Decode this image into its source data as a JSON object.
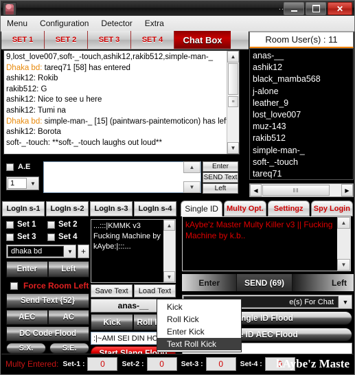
{
  "window": {
    "app_icon": "app-pixel-icon",
    "overflow_dots": "...",
    "minimize": "–",
    "maximize": "□",
    "close": "✕"
  },
  "menubar": {
    "items": [
      "Menu",
      "Configuration",
      "Detector",
      "Extra"
    ]
  },
  "set_tabs": {
    "items": [
      "SET 1",
      "SET 2",
      "SET 3",
      "SET 4"
    ],
    "selected": "Chat Box"
  },
  "room_header": {
    "text": "Room User(s) : 11"
  },
  "chat": {
    "lines": [
      {
        "nick": "",
        "text": "9,lost_love007,soft-_-touch,ashik12,rakib512,simple-man-_"
      },
      {
        "nick": "Dhaka bd:",
        "text": " tareq71 [58] has entered"
      },
      {
        "nick": "",
        "text": "ashik12: Rokib"
      },
      {
        "nick": "",
        "text": "rakib512: G"
      },
      {
        "nick": "",
        "text": "ashik12: Nice to see u here"
      },
      {
        "nick": "",
        "text": "ashik12: Tumi na"
      },
      {
        "nick": "Dhaka bd:",
        "text": " simple-man-_ [15] (paintwars-paintemoticon) has left"
      },
      {
        "nick": "",
        "text": "ashik12: Borota"
      },
      {
        "nick": "",
        "text": "soft-_-touch: **soft-_-touch laughs out loud**"
      }
    ],
    "scroll_up": "▲",
    "scroll_down": "▼",
    "thumb_grip": "≡"
  },
  "user_list": {
    "users": [
      "anas-__",
      "ashik12",
      "black_mamba568",
      "j-alone",
      "leather_9",
      "lost_love007",
      "muz-143",
      "rakib512",
      "simple-man-_",
      "soft-_-touch",
      "tareq71"
    ],
    "scroll_left": "◀",
    "scroll_right": "▶",
    "thumb_grip": "‖‖"
  },
  "chat_input": {
    "ae_label": "A.E",
    "count_value": "1",
    "count_arrow": "▼",
    "message_value": "",
    "scroll_up": "▲",
    "scroll_down": "▼",
    "buttons": [
      "Enter",
      "SEND Text",
      "Left"
    ]
  },
  "login_tabs": {
    "items": [
      "LogIn s-1",
      "LogIn s-2",
      "LogIn s-3",
      "LogIn s-4"
    ]
  },
  "left_panel": {
    "set_checks": [
      "Set 1",
      "Set 2",
      "Set 3",
      "Set 4"
    ],
    "room_value": "dhaka bd",
    "room_arrow": "▼",
    "add_label": "+",
    "enter_label": "Enter",
    "left_label": "Left",
    "force_room_left": "Force Room Left",
    "send_text": "Send Text  {52}",
    "aec": "AEC",
    "ac": "AC",
    "dc_code_flood": "DC Code Flood",
    "sx": "S.X.",
    "se": "S.E."
  },
  "text_editor": {
    "content": "...:::|KMMK v3 Fucking Machine by  kAybe:|:::...",
    "scroll_up": "▲",
    "scroll_down": "▼",
    "save_label": "Save Text",
    "load_label": "Load Text",
    "name_value": "anas-__",
    "kick_label": "Kick",
    "roll_label": "Roll Kick",
    "slang_value": ":|~AMI SEI DIN HO",
    "start_slang": "Start Slang Flood"
  },
  "single_id": {
    "tabs": [
      "Single ID",
      "Multy Opt.",
      "Settingz",
      "Spy Login"
    ],
    "selected_tab": "Single ID",
    "message": " kAybe'z Master Multy Killer v3   || Fucking Machine by  k.b..",
    "scroll_up": "▲",
    "scroll_down": "▼",
    "enter_label": "Enter",
    "send_label": "SEND (69)",
    "left_label": "Left",
    "chat_combo_value": "e(s) For Chat",
    "chat_combo_arrow": "▼",
    "flood_one": "ngle ID Flood",
    "flood_two": "le ID AEC Flood"
  },
  "context_menu": {
    "items": [
      "Kick",
      "Roll Kick",
      "Enter Kick",
      "Text Roll Kick"
    ],
    "highlighted": "Text Roll Kick"
  },
  "status_bar": {
    "label": "Multy Entered:",
    "sets": [
      {
        "key": "Set-1 :",
        "value": "0"
      },
      {
        "key": "Set-2 :",
        "value": "0"
      },
      {
        "key": "Set-3 :",
        "value": "0"
      },
      {
        "key": "Set-4 :",
        "value": "0"
      }
    ],
    "brand": "kAybe'z Maste"
  },
  "colors": {
    "accent_red": "#cc0000",
    "nick_orange": "#e8890a",
    "room_underline": "#f0820a"
  }
}
